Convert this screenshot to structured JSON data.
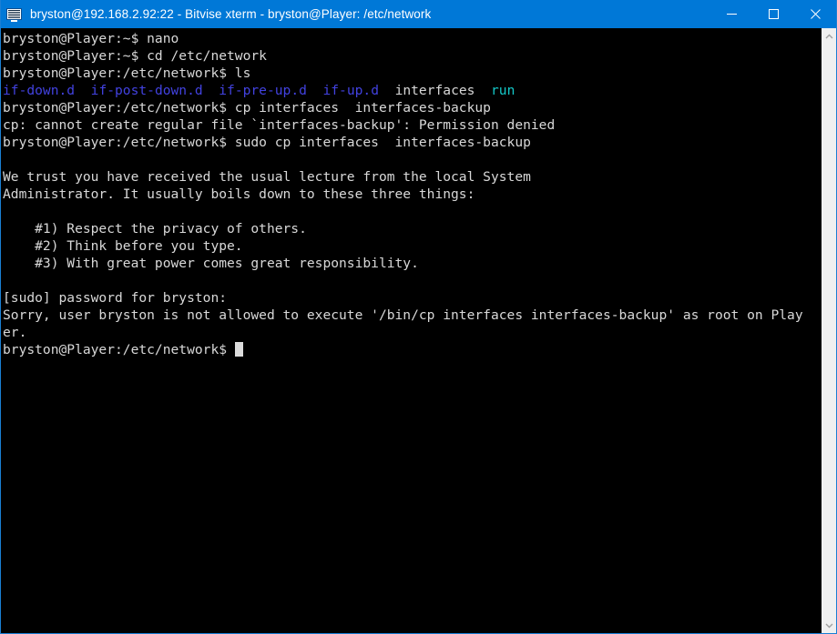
{
  "window": {
    "title": "bryston@192.168.2.92:22 - Bitvise xterm - bryston@Player: /etc/network",
    "icon": "terminal-monitor-icon",
    "accent_color": "#0078d7",
    "border_color": "#1a7fd4"
  },
  "controls": {
    "minimize_label": "Minimize",
    "maximize_label": "Maximize",
    "close_label": "Close"
  },
  "scrollbar": {
    "up_label": "Scroll up",
    "down_label": "Scroll down"
  },
  "terminal": {
    "background_color": "#000000",
    "foreground_color": "#d8d8d8",
    "dir_color": "#4242e0",
    "link_color": "#14c8c8",
    "cursor_color": "#dcdcdc",
    "prompt_home": "bryston@Player:~$",
    "prompt_net": "bryston@Player:/etc/network$",
    "lines": [
      {
        "id": "l01",
        "segments": [
          {
            "text": "bryston@Player:~$ nano",
            "color": "white"
          }
        ]
      },
      {
        "id": "l02",
        "segments": [
          {
            "text": "bryston@Player:~$ cd /etc/network",
            "color": "white"
          }
        ]
      },
      {
        "id": "l03",
        "segments": [
          {
            "text": "bryston@Player:/etc/network$ ls",
            "color": "white"
          }
        ]
      },
      {
        "id": "l04",
        "segments": [
          {
            "text": "if-down.d",
            "color": "blue"
          },
          {
            "text": "  ",
            "color": "white"
          },
          {
            "text": "if-post-down.d",
            "color": "blue"
          },
          {
            "text": "  ",
            "color": "white"
          },
          {
            "text": "if-pre-up.d",
            "color": "blue"
          },
          {
            "text": "  ",
            "color": "white"
          },
          {
            "text": "if-up.d",
            "color": "blue"
          },
          {
            "text": "  interfaces  ",
            "color": "white"
          },
          {
            "text": "run",
            "color": "cyan"
          }
        ]
      },
      {
        "id": "l05",
        "segments": [
          {
            "text": "bryston@Player:/etc/network$ cp interfaces  interfaces-backup",
            "color": "white"
          }
        ]
      },
      {
        "id": "l06",
        "segments": [
          {
            "text": "cp: cannot create regular file `interfaces-backup': Permission denied",
            "color": "white"
          }
        ]
      },
      {
        "id": "l07",
        "segments": [
          {
            "text": "bryston@Player:/etc/network$ sudo cp interfaces  interfaces-backup",
            "color": "white"
          }
        ]
      },
      {
        "id": "l08",
        "segments": [
          {
            "text": " ",
            "color": "white"
          }
        ]
      },
      {
        "id": "l09",
        "segments": [
          {
            "text": "We trust you have received the usual lecture from the local System",
            "color": "white"
          }
        ]
      },
      {
        "id": "l10",
        "segments": [
          {
            "text": "Administrator. It usually boils down to these three things:",
            "color": "white"
          }
        ]
      },
      {
        "id": "l11",
        "segments": [
          {
            "text": " ",
            "color": "white"
          }
        ]
      },
      {
        "id": "l12",
        "segments": [
          {
            "text": "    #1) Respect the privacy of others.",
            "color": "white"
          }
        ]
      },
      {
        "id": "l13",
        "segments": [
          {
            "text": "    #2) Think before you type.",
            "color": "white"
          }
        ]
      },
      {
        "id": "l14",
        "segments": [
          {
            "text": "    #3) With great power comes great responsibility.",
            "color": "white"
          }
        ]
      },
      {
        "id": "l15",
        "segments": [
          {
            "text": " ",
            "color": "white"
          }
        ]
      },
      {
        "id": "l16",
        "segments": [
          {
            "text": "[sudo] password for bryston:",
            "color": "white"
          }
        ]
      },
      {
        "id": "l17",
        "segments": [
          {
            "text": "Sorry, user bryston is not allowed to execute '/bin/cp interfaces interfaces-backup' as root on Play",
            "color": "white"
          }
        ]
      },
      {
        "id": "l18",
        "segments": [
          {
            "text": "er.",
            "color": "white"
          }
        ]
      },
      {
        "id": "l19",
        "segments": [
          {
            "text": "bryston@Player:/etc/network$ ",
            "color": "white"
          }
        ],
        "cursor": true
      }
    ]
  }
}
